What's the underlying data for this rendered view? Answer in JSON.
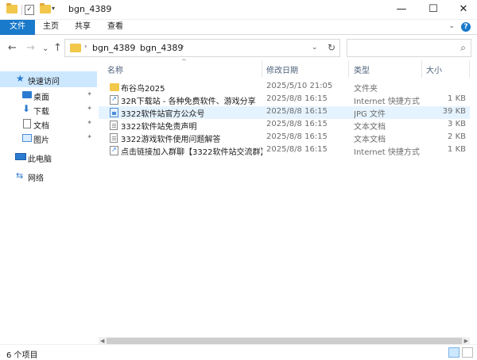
{
  "window": {
    "title": "bgn_4389",
    "minimize": "—",
    "maximize": "☐",
    "close": "✕"
  },
  "ribbon": {
    "tabs": [
      {
        "label": "文件",
        "active": true
      },
      {
        "label": "主页",
        "active": false
      },
      {
        "label": "共享",
        "active": false
      },
      {
        "label": "查看",
        "active": false
      }
    ],
    "help": "?"
  },
  "nav": {
    "back": "←",
    "forward": "→",
    "recent": "⌄",
    "up": "↑"
  },
  "address": {
    "crumbs": [
      "bgn_4389",
      "bgn_4389"
    ],
    "separator": "›",
    "dropdown": "⌄",
    "refresh": "↻"
  },
  "search": {
    "placeholder": "",
    "icon": "search-icon"
  },
  "sidebar": {
    "quick_access": "快速访问",
    "items": [
      {
        "label": "桌面",
        "icon": "desktop-icon",
        "pinned": true
      },
      {
        "label": "下载",
        "icon": "download-icon",
        "pinned": true
      },
      {
        "label": "文档",
        "icon": "document-icon",
        "pinned": true
      },
      {
        "label": "图片",
        "icon": "pictures-icon",
        "pinned": true
      }
    ],
    "this_pc": "此电脑",
    "network": "网络",
    "pin_glyph": "📌"
  },
  "columns": {
    "name": "名称",
    "date": "修改日期",
    "type": "类型",
    "size": "大小"
  },
  "files": [
    {
      "name": "布谷鸟2025",
      "date": "2025/5/10 21:05",
      "type": "文件夹",
      "size": "",
      "icon": "folder-icon"
    },
    {
      "name": "32R下载站 - 各种免费软件、游戏分享",
      "date": "2025/8/8 16:15",
      "type": "Internet 快捷方式",
      "size": "1 KB",
      "icon": "url-shortcut-icon"
    },
    {
      "name": "3322软件站官方公众号",
      "date": "2025/8/8 16:15",
      "type": "JPG 文件",
      "size": "39 KB",
      "icon": "jpg-file-icon"
    },
    {
      "name": "3322软件站免责声明",
      "date": "2025/8/8 16:15",
      "type": "文本文档",
      "size": "3 KB",
      "icon": "text-file-icon"
    },
    {
      "name": "3322游戏软件使用问题解答",
      "date": "2025/8/8 16:15",
      "type": "文本文档",
      "size": "2 KB",
      "icon": "text-file-icon"
    },
    {
      "name": "点击链接加入群聊【3322软件站交流群】",
      "date": "2025/8/8 16:15",
      "type": "Internet 快捷方式",
      "size": "1 KB",
      "icon": "url-shortcut-icon"
    }
  ],
  "status": {
    "count": "6 个项目"
  },
  "colors": {
    "accent": "#1979ca",
    "selection": "#cce8ff",
    "hover_row": "#e5f3ff",
    "folder": "#f2c84b"
  }
}
